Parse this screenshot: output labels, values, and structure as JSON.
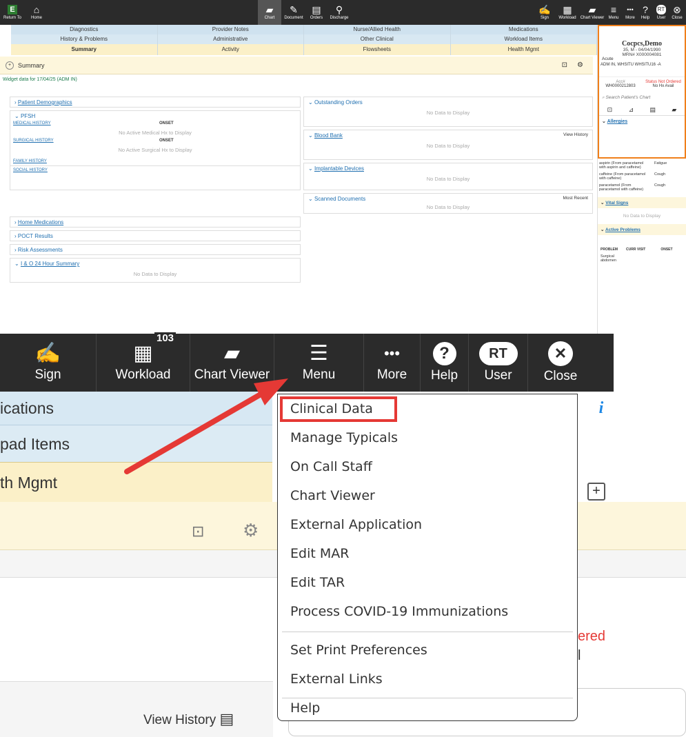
{
  "topbar": {
    "left": [
      {
        "label": "Return To",
        "icon": "E"
      },
      {
        "label": "Home",
        "icon": "⌂"
      }
    ],
    "center": [
      {
        "label": "Chart",
        "icon": "▰"
      },
      {
        "label": "Document",
        "icon": "✎"
      },
      {
        "label": "Orders",
        "icon": "▤"
      },
      {
        "label": "Discharge",
        "icon": "⚲"
      }
    ],
    "right": [
      {
        "label": "Sign",
        "icon": "✍"
      },
      {
        "label": "Workload",
        "icon": "▦"
      },
      {
        "label": "Chart Viewer",
        "icon": "▰"
      },
      {
        "label": "Menu",
        "icon": "≡"
      },
      {
        "label": "More",
        "icon": "•••"
      },
      {
        "label": "Help",
        "icon": "?"
      },
      {
        "label": "User",
        "icon": "RT"
      },
      {
        "label": "Close",
        "icon": "⊗"
      }
    ]
  },
  "tabs": {
    "row1": [
      "Diagnostics",
      "Provider Notes",
      "Nurse/Allied Health",
      "Medications"
    ],
    "row2": [
      "History & Problems",
      "Administrative",
      "Other Clinical",
      "Workload Items"
    ],
    "row3": [
      "Summary",
      "Activity",
      "Flowsheets",
      "Health Mgmt"
    ]
  },
  "summary_title": "Summary",
  "widget_date": "Widget data for 17/04/25 (ADM IN)",
  "left": {
    "patient_demographics": "Patient Demographics",
    "pfsh": "PFSH",
    "medical_history": "MEDICAL HISTORY",
    "onset": "ONSET",
    "no_medical": "No Active Medical Hx to Display",
    "surgical_history": "SURGICAL HISTORY",
    "no_surgical": "No Active Surgical Hx to Display",
    "family_history": "FAMILY HISTORY",
    "social_history": "SOCIAL HISTORY",
    "home_meds": "Home Medications",
    "poct": "POCT Results",
    "risk": "Risk Assessments",
    "io": "I & O 24 Hour Summary",
    "no_data": "No Data to Display"
  },
  "mid": {
    "outstanding": "Outstanding Orders",
    "blood_bank": "Blood Bank",
    "view_history": "View History",
    "implantable": "Implantable Devices",
    "scanned": "Scanned Documents",
    "most_recent": "Most Recent",
    "no_data": "No Data to Display"
  },
  "side": {
    "patient_name": "Cocpcs,Demo",
    "acute": "Acute",
    "age": "35, M - 04/04/1990",
    "mrn": "MRN# X000004081",
    "loc": "ADM IN, WHSITU  WHSITU16 -A",
    "acc_label": "Acc#",
    "acc": "WH0000212803",
    "status": "Status Not Ordered",
    "nohx": "No Hx Avail",
    "search": "Search Patient's Chart",
    "allergies": "Allergies",
    "allergy_list": [
      {
        "name": "aspirin (From paracetamol with aspirin and caffeine)",
        "reaction": "Fatigue"
      },
      {
        "name": "caffeine (From paracetamol with caffeine)",
        "reaction": "Cough"
      },
      {
        "name": "paracetamol (From paracetamol with caffeine)",
        "reaction": "Cough"
      }
    ],
    "vital_signs": "Vital Signs",
    "no_data": "No Data to Display",
    "active_problems": "Active Problems",
    "problem": "PROBLEM",
    "curr": "CURR VISIT",
    "onset": "ONSET",
    "surgical": "Surgical abdomen"
  },
  "bigbar": {
    "sign": "Sign",
    "workload": "Workload",
    "workload_badge": "103",
    "chart_viewer": "Chart Viewer",
    "menu": "Menu",
    "more": "More",
    "help": "Help",
    "user": "User",
    "user_initials": "RT",
    "close": "Close"
  },
  "zoom": {
    "tab1": "ications",
    "tab2": "pad Items",
    "tab3": "th Mgmt",
    "status_partial": "ered",
    "status2_partial": "l",
    "view_history": "View History"
  },
  "menu": {
    "items": [
      "Clinical Data",
      "Manage Typicals",
      "On Call Staff",
      "Chart Viewer",
      "External Application",
      "Edit MAR",
      "Edit TAR",
      "Process COVID-19 Immunizations"
    ],
    "items2": [
      "Set Print Preferences",
      "External Links"
    ],
    "items3": [
      "Help"
    ]
  },
  "colors": {
    "highlight": "#e53935",
    "arrow": "#e53935",
    "sidebar_border": "#f07f1a",
    "link": "#1f6fb0"
  }
}
